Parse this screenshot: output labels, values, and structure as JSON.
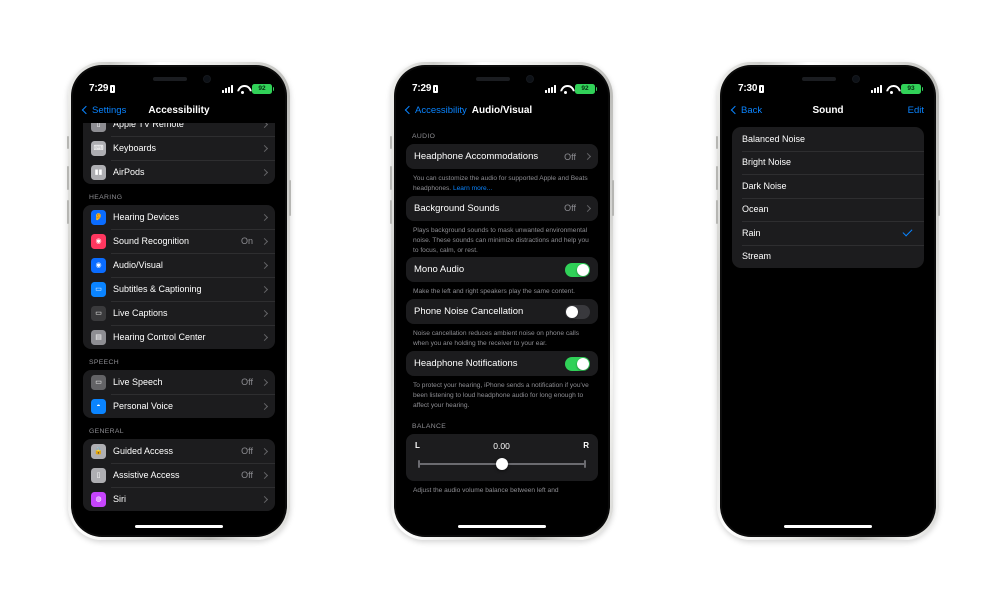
{
  "phones": [
    {
      "id": "phone-accessibility",
      "status": {
        "time": "7:29",
        "battery": "92",
        "lock_icon": "lock-icon",
        "signal_icon": "cellular-bars-icon",
        "wifi_icon": "wifi-icon",
        "battery_icon": "battery-icon"
      },
      "nav": {
        "back_label": "Settings",
        "title": "Accessibility",
        "right_label": ""
      },
      "sections": [
        {
          "header": "",
          "rows": [
            {
              "label": "Apple TV Remote",
              "value": "",
              "icon": "apple-tv-remote-icon",
              "icon_color": "#8e8e93",
              "glyph": "▯",
              "accessory": "chevron"
            },
            {
              "label": "Keyboards",
              "value": "",
              "icon": "keyboard-icon",
              "icon_color": "#aeaeb2",
              "glyph": "⌨",
              "accessory": "chevron"
            },
            {
              "label": "AirPods",
              "value": "",
              "icon": "airpods-icon",
              "icon_color": "#aeaeb2",
              "glyph": "▮▮",
              "accessory": "chevron"
            }
          ]
        },
        {
          "header": "HEARING",
          "rows": [
            {
              "label": "Hearing Devices",
              "value": "",
              "icon": "hearing-devices-icon",
              "icon_color": "#0a6cff",
              "glyph": "👂",
              "accessory": "chevron"
            },
            {
              "label": "Sound Recognition",
              "value": "On",
              "icon": "sound-recognition-icon",
              "icon_color": "#ff375f",
              "glyph": "◉",
              "accessory": "chevron"
            },
            {
              "label": "Audio/Visual",
              "value": "",
              "icon": "audio-visual-icon",
              "icon_color": "#0a6cff",
              "glyph": "◉",
              "accessory": "chevron"
            },
            {
              "label": "Subtitles & Captioning",
              "value": "",
              "icon": "subtitles-icon",
              "icon_color": "#0a84ff",
              "glyph": "▭",
              "accessory": "chevron"
            },
            {
              "label": "Live Captions",
              "value": "",
              "icon": "live-captions-icon",
              "icon_color": "#3a3a3c",
              "glyph": "▭",
              "accessory": "chevron"
            },
            {
              "label": "Hearing Control Center",
              "value": "",
              "icon": "hearing-control-center-icon",
              "icon_color": "#8e8e93",
              "glyph": "▤",
              "accessory": "chevron"
            }
          ]
        },
        {
          "header": "SPEECH",
          "rows": [
            {
              "label": "Live Speech",
              "value": "Off",
              "icon": "live-speech-icon",
              "icon_color": "#636366",
              "glyph": "▭",
              "accessory": "chevron"
            },
            {
              "label": "Personal Voice",
              "value": "",
              "icon": "personal-voice-icon",
              "icon_color": "#0a84ff",
              "glyph": "◓",
              "accessory": "chevron"
            }
          ]
        },
        {
          "header": "GENERAL",
          "rows": [
            {
              "label": "Guided Access",
              "value": "Off",
              "icon": "guided-access-icon",
              "icon_color": "#aeaeb2",
              "glyph": "🔒",
              "accessory": "chevron"
            },
            {
              "label": "Assistive Access",
              "value": "Off",
              "icon": "assistive-access-icon",
              "icon_color": "#aeaeb2",
              "glyph": "▯",
              "accessory": "chevron"
            },
            {
              "label": "Siri",
              "value": "",
              "icon": "siri-icon",
              "icon_color": "#c644fc",
              "glyph": "◍",
              "accessory": "chevron"
            }
          ]
        }
      ]
    },
    {
      "id": "phone-audio-visual",
      "status": {
        "time": "7:29",
        "battery": "92"
      },
      "nav": {
        "back_label": "Accessibility",
        "title": "Audio/Visual",
        "right_label": ""
      },
      "audio_header": "AUDIO",
      "items": [
        {
          "type": "nav",
          "label": "Headphone Accommodations",
          "value": "Off",
          "footnote": "You can customize the audio for supported Apple and Beats headphones. ",
          "footnote_link": "Learn more..."
        },
        {
          "type": "nav",
          "label": "Background Sounds",
          "value": "Off",
          "footnote": "Plays background sounds to mask unwanted environmental noise. These sounds can minimize distractions and help you to focus, calm, or rest.",
          "footnote_link": ""
        },
        {
          "type": "toggle",
          "label": "Mono Audio",
          "state": "on",
          "footnote": "Make the left and right speakers play the same content.",
          "footnote_link": ""
        },
        {
          "type": "toggle",
          "label": "Phone Noise Cancellation",
          "state": "off",
          "footnote": "Noise cancellation reduces ambient noise on phone calls when you are holding the receiver to your ear.",
          "footnote_link": ""
        },
        {
          "type": "toggle",
          "label": "Headphone Notifications",
          "state": "on",
          "footnote": "To protect your hearing, iPhone sends a notification if you've been listening to loud headphone audio for long enough to affect your hearing.",
          "footnote_link": ""
        }
      ],
      "balance": {
        "header": "BALANCE",
        "left_label": "L",
        "right_label": "R",
        "value": "0.00",
        "position_percent": 50,
        "footnote": "Adjust the audio volume balance between left and"
      }
    },
    {
      "id": "phone-sound",
      "status": {
        "time": "7:30",
        "battery": "93"
      },
      "nav": {
        "back_label": "Back",
        "title": "Sound",
        "right_label": "Edit"
      },
      "sounds": [
        {
          "label": "Balanced Noise",
          "selected": false
        },
        {
          "label": "Bright Noise",
          "selected": false
        },
        {
          "label": "Dark Noise",
          "selected": false
        },
        {
          "label": "Ocean",
          "selected": false
        },
        {
          "label": "Rain",
          "selected": true
        },
        {
          "label": "Stream",
          "selected": false
        }
      ]
    }
  ],
  "colors": {
    "accent_blue": "#0a84ff",
    "toggle_green": "#30d158",
    "group_bg": "#1c1c1e",
    "secondary_text": "#8e8e93",
    "battery_green": "#31d158"
  }
}
